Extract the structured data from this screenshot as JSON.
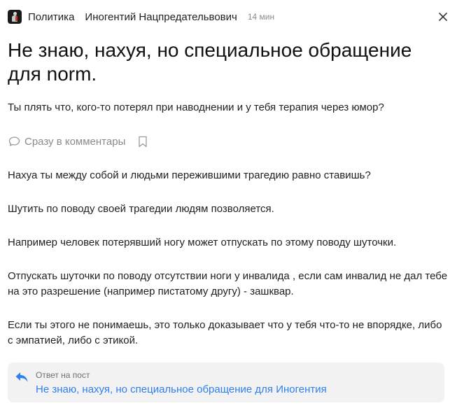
{
  "header": {
    "community": "Политика",
    "author": "Иногентий Нацпредательвович",
    "time": "14 мин",
    "avatar_icon": "avatar-figure-icon",
    "close_icon": "close-icon"
  },
  "post": {
    "title": "Не знаю, нахуя, но специальное обращение для norm.",
    "subtitle": "Ты плять что, кого-то потерял при наводнении и у тебя терапия через юмор?",
    "comments_label": "Сразу в комментары",
    "comment_icon": "comment-bubble-icon",
    "bookmark_icon": "bookmark-icon",
    "paragraphs": [
      "Нахуа ты между собой и людьми пережившими трагедию равно ставишь?",
      "Шутить по поводу своей трагедии людям позволяется.",
      "Например человек потерявший ногу может отпускать по этому поводу шуточки.",
      "Отпускать шуточки по поводу отсутствии ноги у инвалида , если сам инвалид не дал тебе на это разрешение (например пистатому другу) - зашквар.",
      "Если ты этого не понимаешь, это только доказывает что у тебя что-то не впорядке, либо с эмпатией, либо с этикой."
    ]
  },
  "reply": {
    "caption": "Ответ на пост",
    "link_text": "Не знаю, нахуя, но специальное обращение для Иногентия",
    "icon": "reply-arrow-icon",
    "accent_color": "#2f80ed"
  }
}
